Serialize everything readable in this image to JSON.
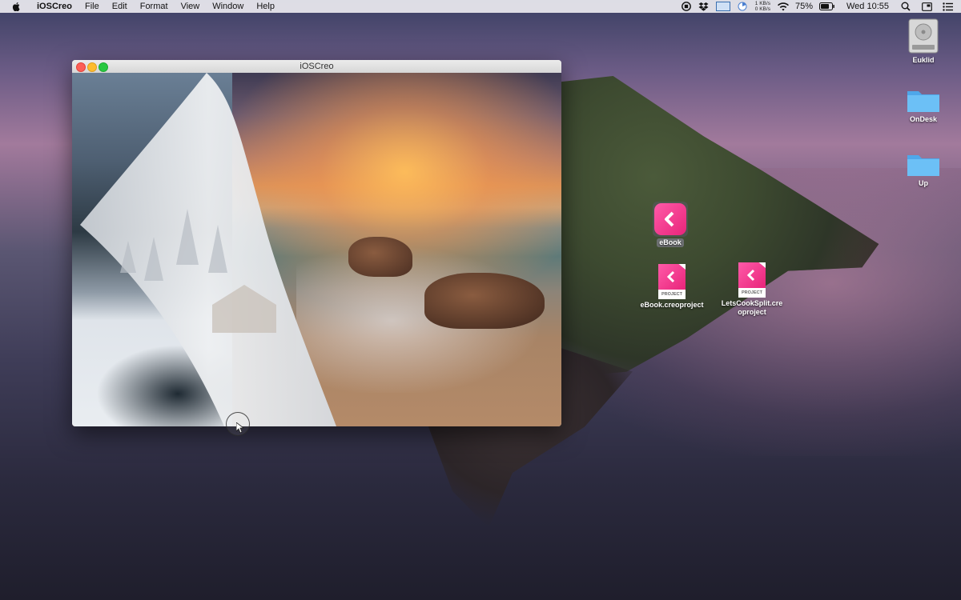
{
  "menubar": {
    "app_name": "iOSCreo",
    "menus": [
      "File",
      "Edit",
      "Format",
      "View",
      "Window",
      "Help"
    ],
    "net_up": "1 KB/s",
    "net_down": "0 KB/s",
    "battery": "75%",
    "clock": "Wed 10:55"
  },
  "window": {
    "title": "iOSCreo"
  },
  "desktop_icons": {
    "drive": "Euklid",
    "folder1": "OnDesk",
    "folder2": "Up",
    "app": "eBook",
    "doc1": "eBook.creoproject",
    "doc2_line1": "LetsCookSplit.cre",
    "doc2_line2": "oproject",
    "doc_badge": "PROJECT"
  },
  "colors": {
    "accent_pink": "#e8247a",
    "folder_blue": "#5fb6f2"
  }
}
